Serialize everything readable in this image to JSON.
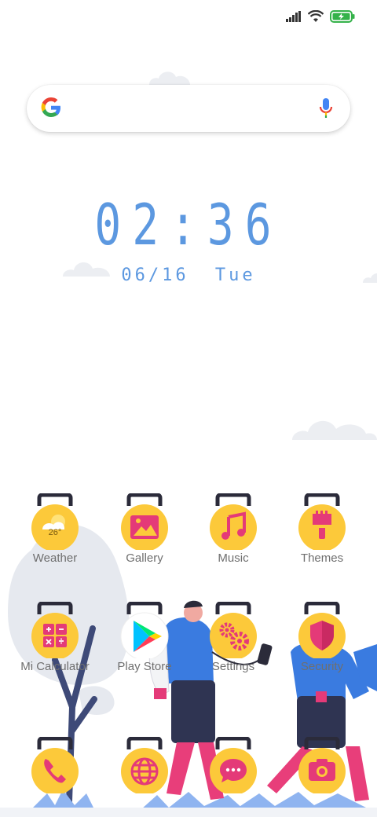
{
  "status_bar": {
    "signal_icon": "signal-icon",
    "wifi_icon": "wifi-icon",
    "battery_icon": "battery-charging-icon"
  },
  "search": {
    "logo": "google-logo-icon",
    "mic": "mic-icon"
  },
  "clock": {
    "time": "02:36",
    "date": "06/16",
    "weekday": "Tue"
  },
  "colors": {
    "accent_blue": "#5c98e0",
    "icon_yellow": "#fcc93a",
    "icon_pink": "#e43a78",
    "handle": "#2b2b3a"
  },
  "apps": [
    {
      "name": "Weather",
      "icon": "weather-icon",
      "temp": "26°"
    },
    {
      "name": "Gallery",
      "icon": "gallery-icon"
    },
    {
      "name": "Music",
      "icon": "music-icon"
    },
    {
      "name": "Themes",
      "icon": "themes-icon"
    },
    {
      "name": "Mi Calculator",
      "icon": "calculator-icon"
    },
    {
      "name": "Play Store",
      "icon": "play-store-icon"
    },
    {
      "name": "Settings",
      "icon": "settings-icon"
    },
    {
      "name": "Security",
      "icon": "security-icon"
    }
  ],
  "dock": [
    {
      "icon": "phone-icon"
    },
    {
      "icon": "browser-icon"
    },
    {
      "icon": "messages-icon"
    },
    {
      "icon": "camera-icon"
    }
  ]
}
